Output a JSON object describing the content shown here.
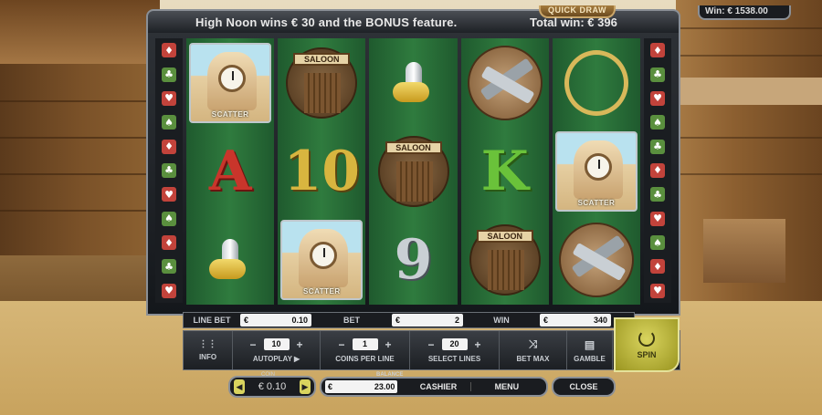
{
  "header": {
    "logo": "QUICK DRAW",
    "win_label": "Win:",
    "win_value": "€ 1538.00",
    "message": "High Noon wins € 30 and the BONUS feature.",
    "total_win": "Total win: € 396"
  },
  "side_suits_left": [
    "♦",
    "♣",
    "♥",
    "♠",
    "♦",
    "♣",
    "♥",
    "♠",
    "♦",
    "♣",
    "♥"
  ],
  "side_suits_right": [
    "♦",
    "♣",
    "♥",
    "♠",
    "♣",
    "♦",
    "♣",
    "♥",
    "♠",
    "♦",
    "♥"
  ],
  "reels": [
    [
      {
        "kind": "scatter",
        "label": "SCATTER"
      },
      {
        "kind": "letter",
        "text": "A",
        "cls": "A"
      },
      {
        "kind": "bullet"
      }
    ],
    [
      {
        "kind": "saloon",
        "label": "SALOON"
      },
      {
        "kind": "letter",
        "text": "10",
        "cls": "ten"
      },
      {
        "kind": "scatter",
        "label": "SCATTER"
      }
    ],
    [
      {
        "kind": "bullet"
      },
      {
        "kind": "saloon",
        "label": "SALOON"
      },
      {
        "kind": "letter",
        "text": "9",
        "cls": "nine"
      }
    ],
    [
      {
        "kind": "guns"
      },
      {
        "kind": "letter",
        "text": "K",
        "cls": "K"
      },
      {
        "kind": "saloon",
        "label": "SALOON"
      }
    ],
    [
      {
        "kind": "lasso"
      },
      {
        "kind": "scatter",
        "label": "SCATTER"
      },
      {
        "kind": "guns"
      }
    ]
  ],
  "bet_strip": {
    "line_bet_label": "LINE BET",
    "line_bet_value": "0.10",
    "bet_label": "BET",
    "bet_value": "2",
    "win_label": "WIN",
    "win_value": "340",
    "currency": "€"
  },
  "controls": {
    "info": "INFO",
    "autoplay_value": "10",
    "autoplay_label": "AUTOPLAY ▶",
    "coins_value": "1",
    "coins_label": "COINS PER LINE",
    "lines_value": "20",
    "lines_label": "SELECT LINES",
    "bet_max": "BET MAX",
    "gamble": "GAMBLE",
    "spin": "SPIN",
    "minus": "−",
    "plus": "+"
  },
  "bottom": {
    "coin_tag": "COIN",
    "coin_value": "€ 0.10",
    "balance_tag": "BALANCE",
    "balance_currency": "€",
    "balance_value": "23.00",
    "cashier": "CASHIER",
    "menu": "MENU",
    "close": "CLOSE"
  },
  "colors": {
    "reel_green": "#2f7b3e",
    "spin_yellow": "#d9d45e"
  }
}
